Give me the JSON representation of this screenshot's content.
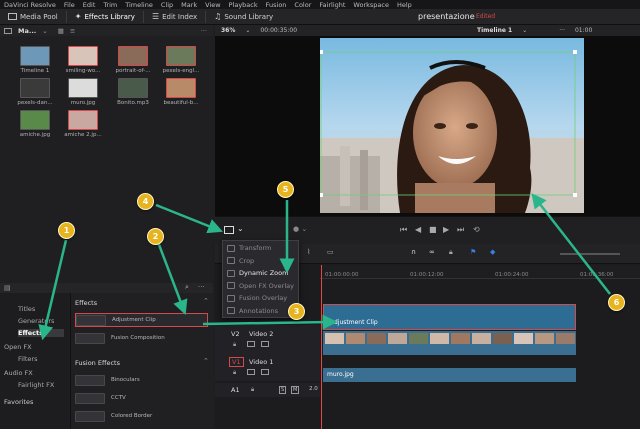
{
  "menu": [
    "DaVinci Resolve",
    "File",
    "Edit",
    "Trim",
    "Timeline",
    "Clip",
    "Mark",
    "View",
    "Playback",
    "Fusion",
    "Color",
    "Fairlight",
    "Workspace",
    "Help"
  ],
  "toolbar": {
    "media_pool": "Media Pool",
    "effects_library": "Effects Library",
    "edit_index": "Edit Index",
    "sound_library": "Sound Library",
    "project_title": "presentazione",
    "edited": "Edited"
  },
  "media_bar": {
    "folder": "Ma..."
  },
  "view_bar": {
    "zoom": "36%",
    "timecode": "00:00:35:00",
    "timeline": "Timeline 1",
    "right_tc": "01:00"
  },
  "media_items": [
    {
      "label": "Timeline 1",
      "color": "#6e98b8",
      "selected": false
    },
    {
      "label": "smiling-wo...",
      "color": "#d8c4b8",
      "selected": true
    },
    {
      "label": "portrait-of-...",
      "color": "#8a6a58",
      "selected": true
    },
    {
      "label": "pexels-engl...",
      "color": "#6a7a5a",
      "selected": true
    },
    {
      "label": "pexels-dan...",
      "color": "#3a3a3a",
      "selected": false
    },
    {
      "label": "muro.jpg",
      "color": "#dcdcdc",
      "selected": false
    },
    {
      "label": "Bonito.mp3",
      "color": "#4a5a4a",
      "selected": false
    },
    {
      "label": "beautiful-b...",
      "color": "#b88a68",
      "selected": true
    },
    {
      "label": "amiche.jpg",
      "color": "#5a8a4a",
      "selected": false
    },
    {
      "label": "amiche 2.jp...",
      "color": "#c8a8a0",
      "selected": true
    }
  ],
  "left_panel": {
    "tree": [
      {
        "label": "Titles"
      },
      {
        "label": "Generators"
      },
      {
        "label": "Effects"
      },
      {
        "label": "Open FX"
      },
      {
        "label": "Filters"
      },
      {
        "label": "Audio FX"
      },
      {
        "label": "Fairlight FX"
      }
    ],
    "favorites": "Favorites"
  },
  "effects": {
    "header": "Effects",
    "items": [
      "Adjustment Clip",
      "Fusion Composition"
    ],
    "fusion_header": "Fusion Effects",
    "fusion_items": [
      "Binoculars",
      "CCTV",
      "Colored Border"
    ]
  },
  "dropdown": {
    "items": [
      {
        "label": "Transform",
        "active": false
      },
      {
        "label": "Crop",
        "active": false
      },
      {
        "label": "Dynamic Zoom",
        "active": true
      },
      {
        "label": "Open FX Overlay",
        "active": false
      },
      {
        "label": "Fusion Overlay",
        "active": false
      },
      {
        "label": "Annotations",
        "active": false
      }
    ]
  },
  "timeline": {
    "ruler": [
      "01:00:00:00",
      "01:00:12:00",
      "01:00:24:00",
      "01:00:36:00"
    ],
    "tracks": [
      {
        "id": "V2",
        "name": "Video 2"
      },
      {
        "id": "V1",
        "name": "Video 1"
      },
      {
        "id": "A1",
        "level": "2.0"
      }
    ],
    "adjustment_clip": "Adjustment Clip",
    "muro_clip": "muro.jpg"
  },
  "badges": [
    "1",
    "2",
    "3",
    "4",
    "5",
    "6"
  ],
  "colors": {
    "accent_red": "#d24a4a",
    "badge_yellow": "#e7b420",
    "arrow_green": "#2bb58b",
    "adj_clip": "#2d6d94"
  }
}
